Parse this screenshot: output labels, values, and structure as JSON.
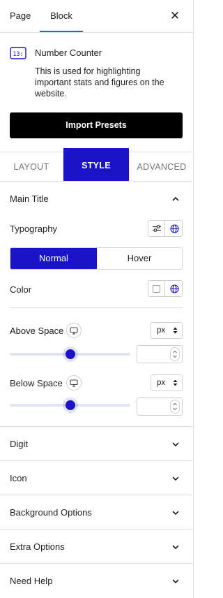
{
  "tabs": {
    "page": "Page",
    "block": "Block"
  },
  "block": {
    "title": "Number Counter",
    "description": "This is used for highlighting important stats and figures on the website.",
    "icon": "number-counter-icon",
    "import_label": "Import Presets"
  },
  "style_tabs": {
    "layout": "LAYOUT",
    "style": "STYLE",
    "advanced": "ADVANCED"
  },
  "main_title": {
    "label": "Main Title",
    "typography_label": "Typography",
    "state_normal": "Normal",
    "state_hover": "Hover",
    "color_label": "Color",
    "above_space": {
      "label": "Above Space",
      "unit": "px",
      "value": "",
      "slider_fraction": 0.5
    },
    "below_space": {
      "label": "Below Space",
      "unit": "px",
      "value": "",
      "slider_fraction": 0.5
    }
  },
  "sections": {
    "digit": "Digit",
    "icon": "Icon",
    "background": "Background Options",
    "extra": "Extra Options",
    "help": "Need Help"
  },
  "colors": {
    "accent": "#1a14c9",
    "tab_underline": "#3858e9"
  }
}
